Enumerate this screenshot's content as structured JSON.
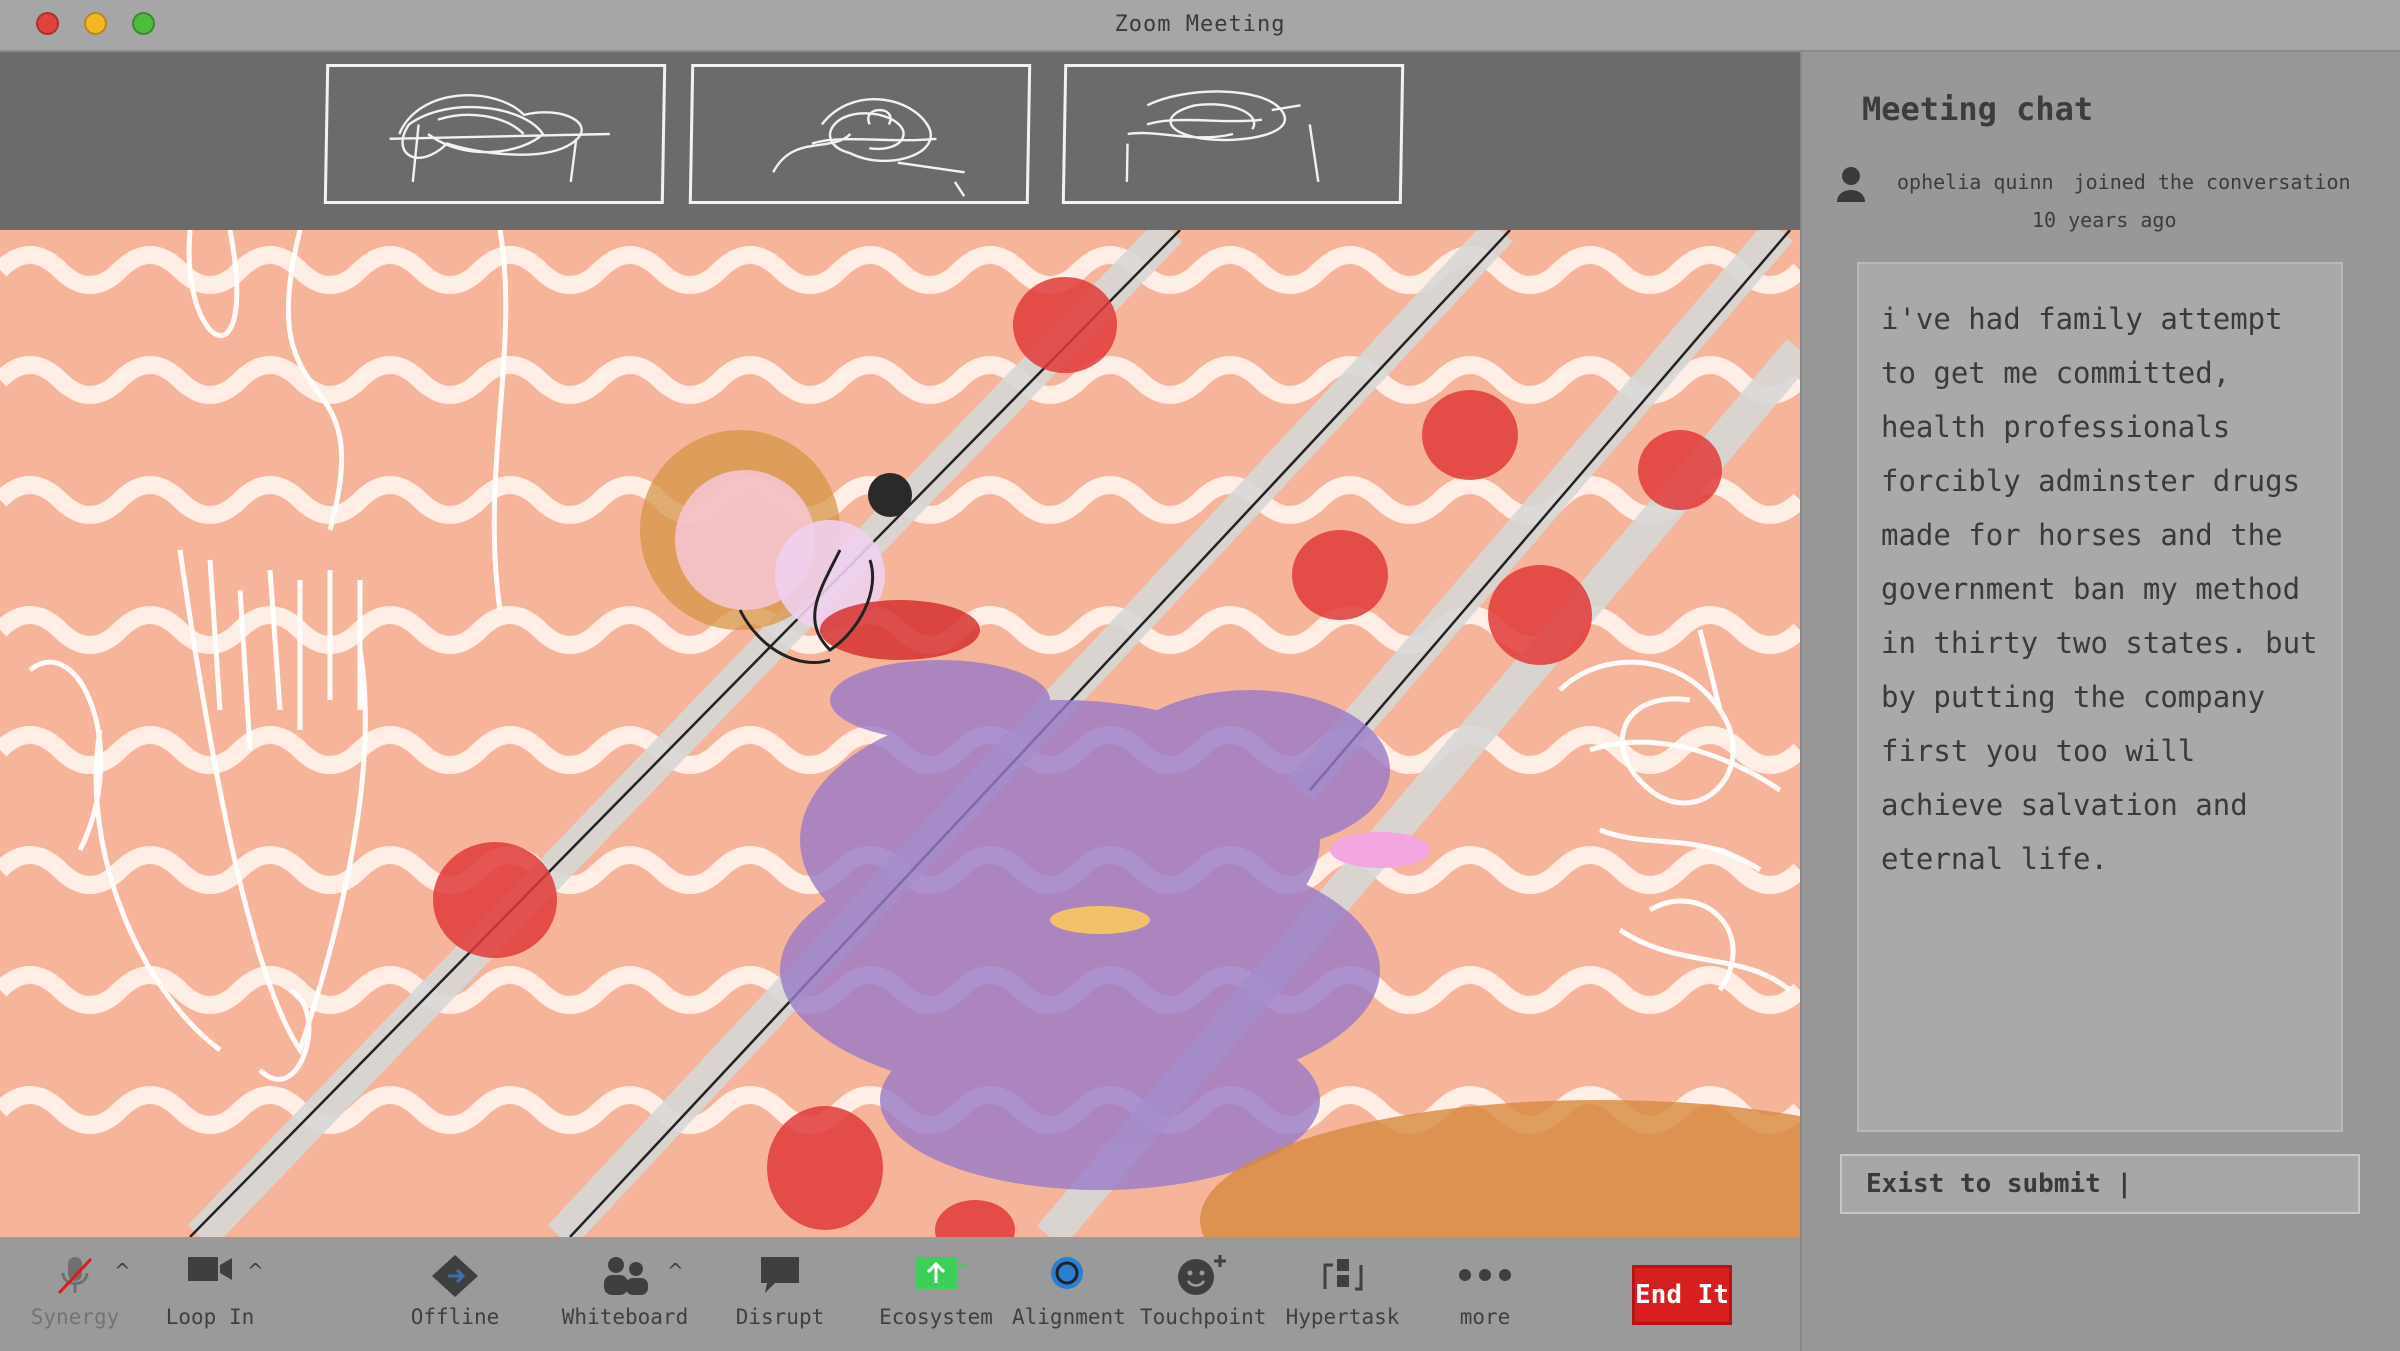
{
  "window": {
    "title": "Zoom Meeting"
  },
  "chat": {
    "title": "Meeting chat",
    "join_name": "ophelia quinn",
    "join_action": "joined the conversation",
    "join_time": "10 years ago",
    "message": "i've had family attempt to get me committed, health professionals forcibly adminster drugs made for horses and the government ban my method in thirty two states. but by putting the company first you too will achieve salvation and eternal life.",
    "input_placeholder": "Exist to submit |"
  },
  "toolbar": {
    "synergy": "Synergy",
    "loop_in": "Loop In",
    "offline": "Offline",
    "whiteboard": "Whiteboard",
    "disrupt": "Disrupt",
    "ecosystem": "Ecosystem",
    "alignment": "Alignment",
    "touchpoint": "Touchpoint",
    "hypertask": "Hypertask",
    "more": "more",
    "end": "End It"
  },
  "colors": {
    "accent_red": "#d81f1f",
    "ecosystem_green": "#3ecf5a",
    "alignment_blue": "#2a7fd4",
    "video_background": "#f6b49a"
  },
  "icons": {
    "synergy": "microphone-muted-icon",
    "loop_in": "video-camera-icon",
    "offline": "diamond-arrow-icon",
    "whiteboard": "people-icon",
    "disrupt": "speech-bubble-icon",
    "ecosystem": "share-screen-icon",
    "alignment": "circle-ring-icon",
    "touchpoint": "smiley-plus-icon",
    "hypertask": "apps-icon",
    "more": "ellipsis-icon"
  }
}
